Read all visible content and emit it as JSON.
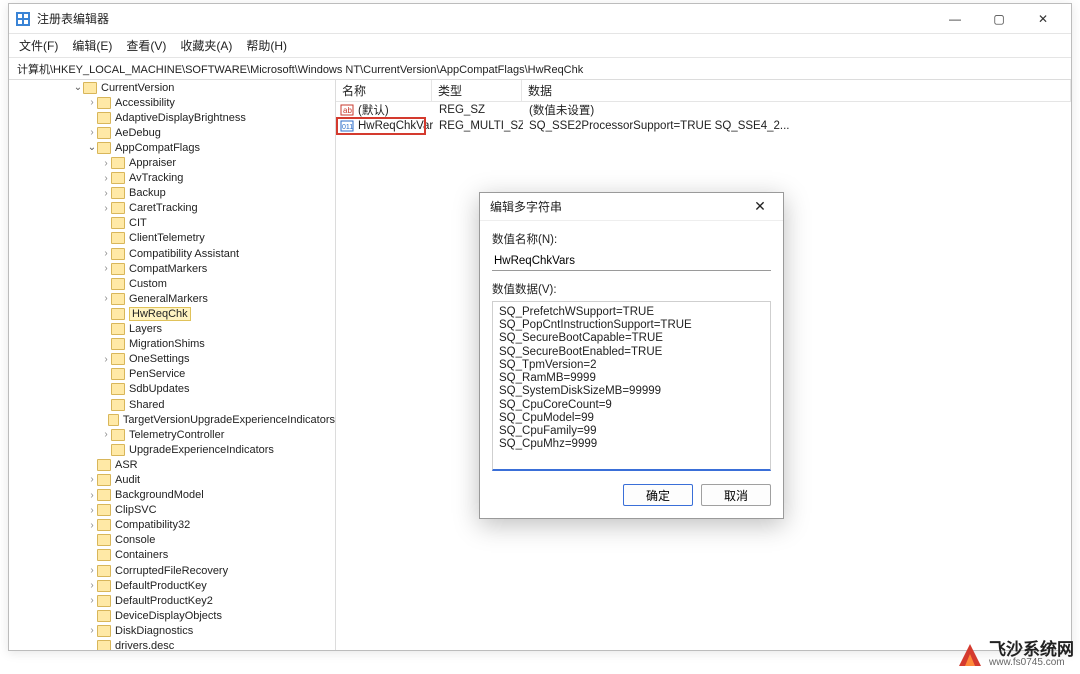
{
  "window": {
    "title": "注册表编辑器",
    "min": "—",
    "max": "▢",
    "close": "✕"
  },
  "menu": [
    "文件(F)",
    "编辑(E)",
    "查看(V)",
    "收藏夹(A)",
    "帮助(H)"
  ],
  "address": "计算机\\HKEY_LOCAL_MACHINE\\SOFTWARE\\Microsoft\\Windows NT\\CurrentVersion\\AppCompatFlags\\HwReqChk",
  "tree": [
    {
      "d": 5,
      "c": "open",
      "n": "CurrentVersion"
    },
    {
      "d": 6,
      "c": "closed",
      "n": "Accessibility"
    },
    {
      "d": 6,
      "c": "none",
      "n": "AdaptiveDisplayBrightness"
    },
    {
      "d": 6,
      "c": "closed",
      "n": "AeDebug"
    },
    {
      "d": 6,
      "c": "open",
      "n": "AppCompatFlags"
    },
    {
      "d": 7,
      "c": "closed",
      "n": "Appraiser"
    },
    {
      "d": 7,
      "c": "closed",
      "n": "AvTracking"
    },
    {
      "d": 7,
      "c": "closed",
      "n": "Backup"
    },
    {
      "d": 7,
      "c": "closed",
      "n": "CaretTracking"
    },
    {
      "d": 7,
      "c": "none",
      "n": "CIT"
    },
    {
      "d": 7,
      "c": "none",
      "n": "ClientTelemetry"
    },
    {
      "d": 7,
      "c": "closed",
      "n": "Compatibility Assistant"
    },
    {
      "d": 7,
      "c": "closed",
      "n": "CompatMarkers"
    },
    {
      "d": 7,
      "c": "none",
      "n": "Custom"
    },
    {
      "d": 7,
      "c": "closed",
      "n": "GeneralMarkers"
    },
    {
      "d": 7,
      "c": "none",
      "n": "HwReqChk",
      "sel": true
    },
    {
      "d": 7,
      "c": "none",
      "n": "Layers"
    },
    {
      "d": 7,
      "c": "none",
      "n": "MigrationShims"
    },
    {
      "d": 7,
      "c": "closed",
      "n": "OneSettings"
    },
    {
      "d": 7,
      "c": "none",
      "n": "PenService"
    },
    {
      "d": 7,
      "c": "none",
      "n": "SdbUpdates"
    },
    {
      "d": 7,
      "c": "none",
      "n": "Shared"
    },
    {
      "d": 7,
      "c": "none",
      "n": "TargetVersionUpgradeExperienceIndicators"
    },
    {
      "d": 7,
      "c": "closed",
      "n": "TelemetryController"
    },
    {
      "d": 7,
      "c": "none",
      "n": "UpgradeExperienceIndicators"
    },
    {
      "d": 6,
      "c": "none",
      "n": "ASR"
    },
    {
      "d": 6,
      "c": "closed",
      "n": "Audit"
    },
    {
      "d": 6,
      "c": "closed",
      "n": "BackgroundModel"
    },
    {
      "d": 6,
      "c": "closed",
      "n": "ClipSVC"
    },
    {
      "d": 6,
      "c": "closed",
      "n": "Compatibility32"
    },
    {
      "d": 6,
      "c": "none",
      "n": "Console"
    },
    {
      "d": 6,
      "c": "none",
      "n": "Containers"
    },
    {
      "d": 6,
      "c": "closed",
      "n": "CorruptedFileRecovery"
    },
    {
      "d": 6,
      "c": "closed",
      "n": "DefaultProductKey"
    },
    {
      "d": 6,
      "c": "closed",
      "n": "DefaultProductKey2"
    },
    {
      "d": 6,
      "c": "none",
      "n": "DeviceDisplayObjects"
    },
    {
      "d": 6,
      "c": "closed",
      "n": "DiskDiagnostics"
    },
    {
      "d": 6,
      "c": "none",
      "n": "drivers.desc"
    }
  ],
  "list": {
    "headers": {
      "name": "名称",
      "type": "类型",
      "data": "数据"
    },
    "rows": [
      {
        "icon": "str",
        "name": "(默认)",
        "type": "REG_SZ",
        "data": "(数值未设置)",
        "hl": false
      },
      {
        "icon": "bin",
        "name": "HwReqChkVars",
        "type": "REG_MULTI_SZ",
        "data": "SQ_SSE2ProcessorSupport=TRUE SQ_SSE4_2...",
        "hl": true
      }
    ]
  },
  "dialog": {
    "title": "编辑多字符串",
    "close": "✕",
    "name_label": "数值名称(N):",
    "name_value": "HwReqChkVars",
    "data_label": "数值数据(V):",
    "data_value": "SQ_PrefetchWSupport=TRUE\nSQ_PopCntInstructionSupport=TRUE\nSQ_SecureBootCapable=TRUE\nSQ_SecureBootEnabled=TRUE\nSQ_TpmVersion=2\nSQ_RamMB=9999\nSQ_SystemDiskSizeMB=99999\nSQ_CpuCoreCount=9\nSQ_CpuModel=99\nSQ_CpuFamily=99\nSQ_CpuMhz=9999",
    "ok": "确定",
    "cancel": "取消"
  },
  "watermark": {
    "line1": "飞沙系统网",
    "line2": "www.fs0745.com"
  }
}
